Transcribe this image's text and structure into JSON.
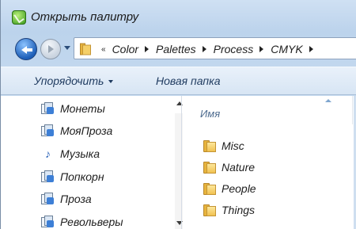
{
  "window": {
    "title": "Открыть палитру"
  },
  "address_bar": {
    "overflow_chevron": "«",
    "crumbs": [
      "Color",
      "Palettes",
      "Process",
      "CMYK"
    ]
  },
  "toolbar": {
    "organize_label": "Упорядочить",
    "new_folder_label": "Новая папка"
  },
  "nav_pane": {
    "items": [
      {
        "label": "Монеты",
        "icon": "library-icon"
      },
      {
        "label": "МояПроза",
        "icon": "library-icon"
      },
      {
        "label": "Музыка",
        "icon": "music-library-icon"
      },
      {
        "label": "Попкорн",
        "icon": "library-icon"
      },
      {
        "label": "Проза",
        "icon": "library-icon"
      },
      {
        "label": "Револьверы",
        "icon": "library-icon"
      }
    ]
  },
  "file_list": {
    "column_name": "Имя",
    "items": [
      {
        "name": "Misc",
        "icon": "folder-icon"
      },
      {
        "name": "Nature",
        "icon": "folder-icon"
      },
      {
        "name": "People",
        "icon": "folder-icon"
      },
      {
        "name": "Things",
        "icon": "folder-icon"
      }
    ]
  },
  "colors": {
    "accent": "#3d7fd6",
    "toolbar_text": "#1e3a5f",
    "header_text": "#4d6b8e",
    "folder": "#f1c251"
  }
}
